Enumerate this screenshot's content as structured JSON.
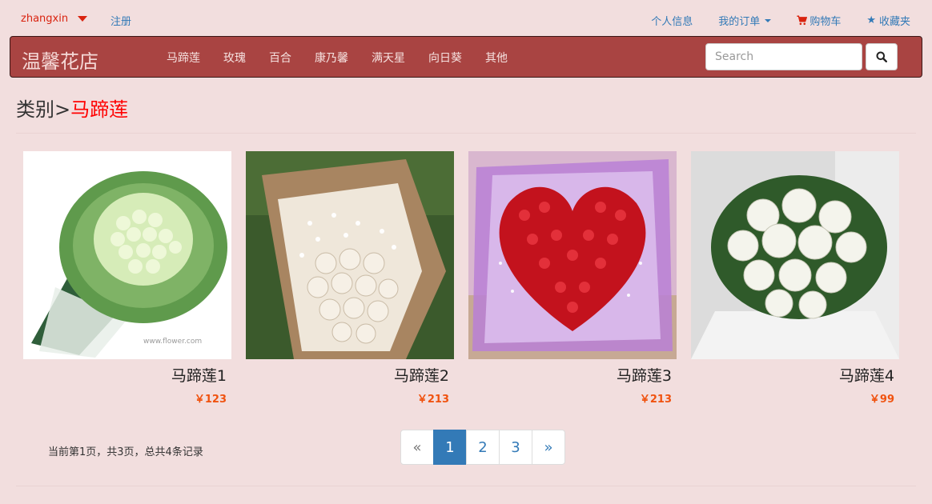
{
  "topbar": {
    "username": "zhangxin",
    "register": "注册",
    "links": {
      "profile": "个人信息",
      "orders": "我的订单",
      "cart": "购物车",
      "favorites": "收藏夹"
    }
  },
  "navbar": {
    "brand": "温馨花店",
    "items": [
      "马蹄莲",
      "玫瑰",
      "百合",
      "康乃馨",
      "满天星",
      "向日葵",
      "其他"
    ],
    "search_placeholder": "Search"
  },
  "heading": {
    "prefix": "类别>",
    "category": "马蹄莲"
  },
  "products": [
    {
      "name": "马蹄莲1",
      "price": "￥123"
    },
    {
      "name": "马蹄莲2",
      "price": "￥213"
    },
    {
      "name": "马蹄莲3",
      "price": "￥213"
    },
    {
      "name": "马蹄莲4",
      "price": "￥99"
    }
  ],
  "pagination": {
    "info": "当前第1页，共3页，总共4条记录",
    "prev": "«",
    "pages": [
      "1",
      "2",
      "3"
    ],
    "active_page": "1",
    "next": "»"
  },
  "colors": {
    "page_bg": "#f2dede",
    "navbar_bg": "#a94442",
    "accent_red": "#d9230f",
    "link_blue": "#337ab7",
    "price_orange": "#f0520f"
  }
}
